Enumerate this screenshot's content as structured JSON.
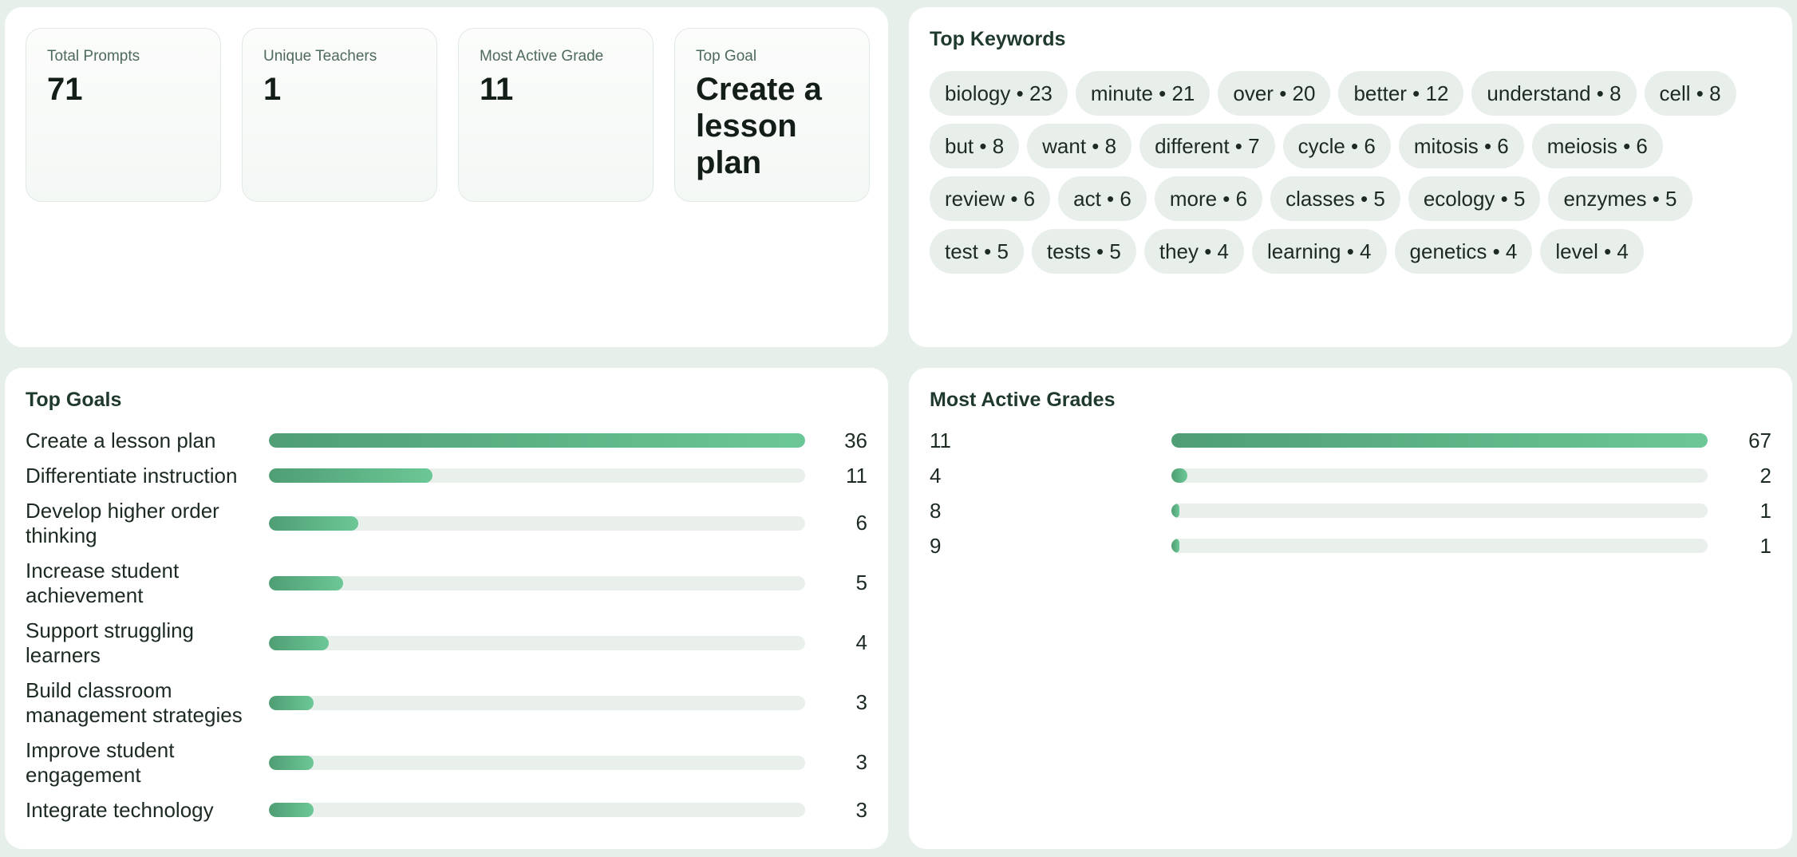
{
  "stats": {
    "cards": [
      {
        "label": "Total Prompts",
        "value": "71"
      },
      {
        "label": "Unique Teachers",
        "value": "1"
      },
      {
        "label": "Most Active Grade",
        "value": "11"
      },
      {
        "label": "Top Goal",
        "value": "Create a lesson plan"
      }
    ]
  },
  "keywords": {
    "title": "Top Keywords",
    "items": [
      "biology • 23",
      "minute • 21",
      "over • 20",
      "better • 12",
      "understand • 8",
      "cell • 8",
      "but • 8",
      "want • 8",
      "different • 7",
      "cycle • 6",
      "mitosis • 6",
      "meiosis • 6",
      "review • 6",
      "act • 6",
      "more • 6",
      "classes • 5",
      "ecology • 5",
      "enzymes • 5",
      "test • 5",
      "tests • 5",
      "they • 4",
      "learning • 4",
      "genetics • 4",
      "level • 4"
    ]
  },
  "goals": {
    "title": "Top Goals",
    "max": 36,
    "items": [
      {
        "label": "Create a lesson plan",
        "count": 36
      },
      {
        "label": "Differentiate instruction",
        "count": 11
      },
      {
        "label": "Develop higher order thinking",
        "count": 6
      },
      {
        "label": "Increase student achievement",
        "count": 5
      },
      {
        "label": "Support struggling learners",
        "count": 4
      },
      {
        "label": "Build classroom management strategies",
        "count": 3
      },
      {
        "label": "Improve student engagement",
        "count": 3
      },
      {
        "label": "Integrate technology",
        "count": 3
      }
    ]
  },
  "grades": {
    "title": "Most Active Grades",
    "max": 67,
    "items": [
      {
        "label": "11",
        "count": 67
      },
      {
        "label": "4",
        "count": 2
      },
      {
        "label": "8",
        "count": 1
      },
      {
        "label": "9",
        "count": 1
      }
    ]
  },
  "colors": {
    "background": "#e7efea",
    "bar_start": "#4f9e74",
    "bar_end": "#6cc796",
    "track": "#e9f0ec",
    "chip": "#e8efeb",
    "title": "#1f3a2c"
  }
}
